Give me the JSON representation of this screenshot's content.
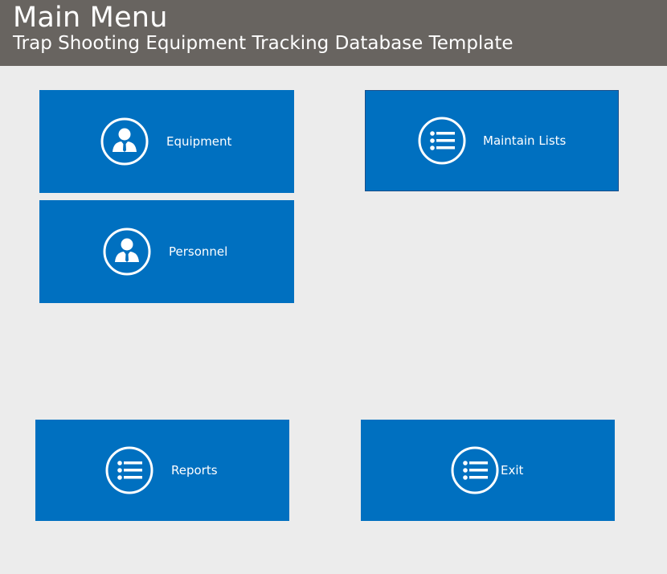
{
  "header": {
    "title": "Main Menu",
    "subtitle": "Trap Shooting Equipment Tracking Database Template"
  },
  "tiles": {
    "equipment": {
      "label": "Equipment",
      "icon": "person-icon"
    },
    "maintain_lists": {
      "label": "Maintain Lists",
      "icon": "list-icon"
    },
    "personnel": {
      "label": "Personnel",
      "icon": "person-icon"
    },
    "reports": {
      "label": "Reports",
      "icon": "list-icon"
    },
    "exit": {
      "label": "Exit",
      "icon": "list-icon"
    }
  },
  "colors": {
    "header_bg": "#686460",
    "page_bg": "#ececec",
    "tile_bg": "#0070c0",
    "tile_text": "#ffffff"
  }
}
